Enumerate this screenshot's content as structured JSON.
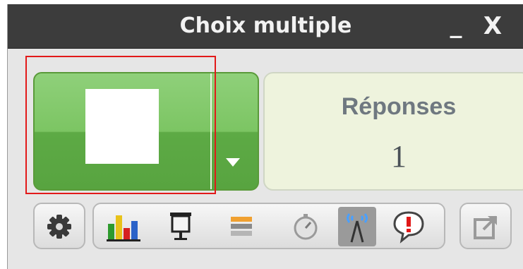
{
  "window": {
    "title": "Choix multiple",
    "minimize_label": "_",
    "close_label": "X"
  },
  "main_button": {
    "color": "#6dbb52"
  },
  "responses": {
    "label": "Réponses",
    "count": "1"
  },
  "toolbar": {
    "icons": [
      "gear-icon",
      "bar-chart-icon",
      "projector-screen-icon",
      "stacked-bars-icon",
      "stopwatch-icon",
      "broadcast-tower-icon",
      "speech-bubble-alert-icon",
      "export-icon"
    ]
  },
  "colors": {
    "titlebar": "#3c3c3c",
    "accent_green": "#6dbb52",
    "selection_outline": "#e21a1a",
    "responses_bg": "#eef3dd"
  }
}
